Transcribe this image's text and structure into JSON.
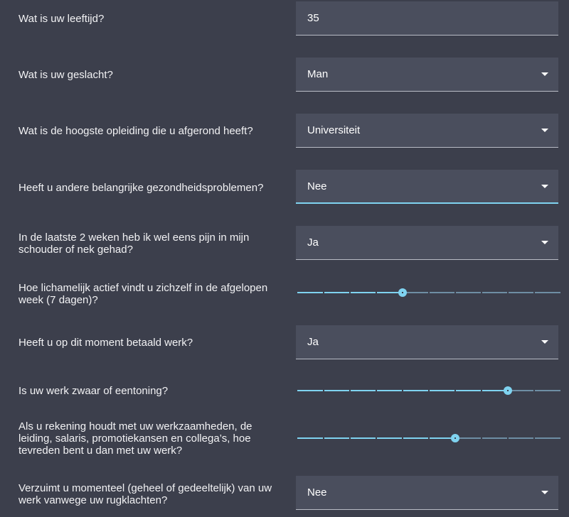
{
  "questions": {
    "age": {
      "label": "Wat is uw leeftijd?",
      "value": "35"
    },
    "gender": {
      "label": "Wat is uw geslacht?",
      "value": "Man"
    },
    "education": {
      "label": "Wat is de hoogste opleiding die u afgerond heeft?",
      "value": "Universiteit"
    },
    "health": {
      "label": "Heeft u andere belangrijke gezondheidsproblemen?",
      "value": "Nee"
    },
    "pain": {
      "label": "In de laatste 2 weken heb ik wel eens pijn in mijn schouder of nek gehad?",
      "value": "Ja"
    },
    "activity": {
      "label": "Hoe lichamelijk actief vindt u zichzelf in de afgelopen week (7 dagen)?",
      "level": 4,
      "max": 10
    },
    "paid_work": {
      "label": "Heeft u op dit moment betaald werk?",
      "value": "Ja"
    },
    "heavy_work": {
      "label": "Is uw werk zwaar of eentoning?",
      "level": 8,
      "max": 10
    },
    "satisfaction": {
      "label": "Als u rekening houdt met uw werkzaamheden, de leiding, salaris, promotiekansen en collega’s, hoe tevreden bent u dan met uw werk?",
      "level": 6,
      "max": 10
    },
    "absence": {
      "label": "Verzuimt u momenteel (geheel of gedeeltelijk) van uw werk vanwege uw rugklachten?",
      "value": "Nee"
    }
  },
  "colors": {
    "background": "#3c3f4c",
    "field_background": "#4a4e5d",
    "accent": "#7fd3f0",
    "track_inactive": "#6e8ea4"
  },
  "icons": {
    "dropdown": "caret-down-icon"
  }
}
